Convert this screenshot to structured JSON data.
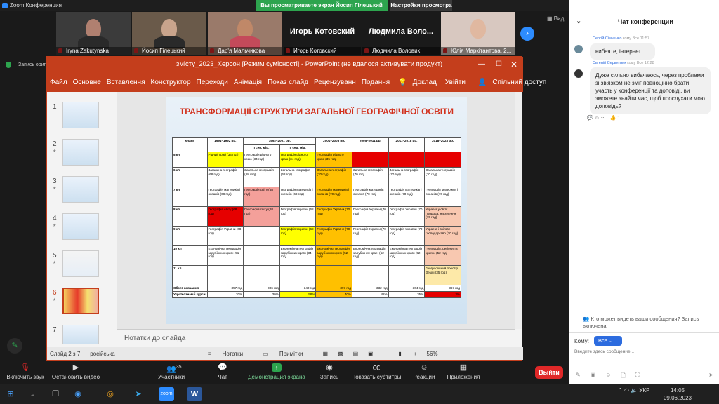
{
  "window": {
    "title": "Zoom Конференция",
    "viewing_banner": "Вы просматриваете экран Йосип Гілецький",
    "view_options": "Настройки просмотра",
    "view_label": "Вид"
  },
  "participants": [
    {
      "name": "Iryna Zakutynska"
    },
    {
      "name": "Йосип Гілецький"
    },
    {
      "name": "Дар'я Мальчикова"
    },
    {
      "name": "Игорь Котовский",
      "bigname": "Игорь Котовский"
    },
    {
      "name": "Людмила Воловик",
      "bigname": "Людмила Воло..."
    },
    {
      "name": "Юлія Маркітантова, 2..."
    }
  ],
  "share_notice": "Запись оригинала звук для музыкантов выключен",
  "ppt": {
    "title": "змісту_2023_Херсон [Режим сумісності] - PowerPoint (не вдалося активувати продукт)",
    "tabs": [
      "Файл",
      "Основне",
      "Вставлення",
      "Конструктор",
      "Переходи",
      "Анімація",
      "Показ слайд",
      "Рецензуванн",
      "Подання",
      "Доклад",
      "Увійти"
    ],
    "share": "Спільний доступ",
    "thumbs": [
      "1",
      "2",
      "3",
      "4",
      "5",
      "6",
      "7"
    ],
    "notes_placeholder": "Нотатки до слайда",
    "status": {
      "slide": "Слайд 2 з 7",
      "lang": "російська",
      "notes": "Нотатки",
      "comments": "Примітки",
      "zoom": "56%"
    }
  },
  "slide": {
    "title": "ТРАНСФОРМАЦІЇ СТРУКТУРИ ЗАГАЛЬНОЇ ГЕОГРАФІЧНОЇ ОСВІТИ",
    "headers": [
      "Класи",
      "1991–1992 рр.",
      "1992–2001 рр.",
      "2001–2005 рр.",
      "2005–2011 рр.",
      "2011–2018 рр.",
      "2018–2023 рр."
    ],
    "subheaders": [
      "І сер. мір.",
      "ІІ сер. мір."
    ],
    "rows": [
      [
        "5 кл",
        "Рідний край (34 год)",
        "Географія рідного краю (34 год)",
        "Географія рідного краю (34 год)",
        "Географія рідного краю (35 год)",
        "",
        "",
        ""
      ],
      [
        "6 кл",
        "Загальна географія (68 год)",
        "Загальна географія (68 год)",
        "Загальна географія (68 год)",
        "Загальна географія (70 год)",
        "Загальна географія (70 год)",
        "Загальна географія (70 год)",
        "Загальна географія (70 год)"
      ],
      [
        "7 кл",
        "Географія материків і океанів (68 год)",
        "Географія світу (68 год)",
        "Географія материків і океанів (68 год)",
        "Географія материків і океанів (70 год)",
        "Географія материків і океанів (70 год)",
        "Географія материків і океанів (70 год)",
        "Географія материків і океанів (70 год)"
      ],
      [
        "8 кл",
        "Географія світу (68 год)",
        "Географія світу (68 год)",
        "Географія України (68 год)",
        "Географія України (70 год)",
        "Географія України (70 год)",
        "Географія України (70 год)",
        "Україна у світі: природа, населення (70 год)"
      ],
      [
        "9 кл",
        "Географія України (68 год)",
        "",
        "Географія України (68 год)",
        "Географія України (70 год)",
        "Географія України (70 год)",
        "Географія України (70 год)",
        "Україна і світове господарство (70 год)"
      ],
      [
        "10 кл",
        "Економічна географія зарубіжних країн (51 год)",
        "",
        "Економічна географія зарубіжних країн (34 год)",
        "Економічна географія зарубіжних країн (52 год)",
        "Економічна географія зарубіжних країн (52 год)",
        "Економічна географія зарубіжних країн (52 год)",
        "Географія: регіони та країни (52 год)"
      ],
      [
        "11 кл",
        "",
        "",
        "",
        "",
        "",
        "",
        "Географічний простір Землі (35 год)"
      ],
      [
        "Обсяг навчання",
        "357 год",
        "306 год",
        "340 год",
        "397 год",
        "332 год",
        "304 год",
        "367 год"
      ],
      [
        "Українознавчі курси",
        "20%",
        "30%",
        "58%",
        "40%",
        "42%",
        "35%",
        "3%"
      ]
    ]
  },
  "chat": {
    "title": "Чат конференции",
    "messages": [
      {
        "from": "Сергій Сімченко",
        "to": "кому Все",
        "time": "11:57",
        "text": "вибачте, інтернет......"
      },
      {
        "from": "Євгеній Сервятник",
        "to": "кому Все",
        "time": "12:28",
        "text": "Дуже сильно вибачаюсь, через проблеми зі зв'язком не зміг повноцінно брати участь у конференції та доповіді, ви зможете знайти час, щоб прослухати мою доповідь?"
      }
    ],
    "reaction_count": "1",
    "privacy_note": "Кто может видеть ваши сообщения? Запись включена",
    "to_label": "Кому:",
    "to_value": "Все",
    "input_placeholder": "Введите здесь сообщение..."
  },
  "toolbar": {
    "mute": "Включить звук",
    "video": "Остановить видео",
    "participants": "Участники",
    "participants_count": "35",
    "chat": "Чат",
    "share": "Демонстрация экрана",
    "record": "Запись",
    "captions": "Показать субтитры",
    "reactions": "Реакции",
    "apps": "Приложения",
    "leave": "Выйти"
  },
  "taskbar": {
    "lang": "УКР",
    "time": "14:05",
    "date": "09.06.2023"
  },
  "colors": {
    "ppt_accent": "#c43e1c",
    "zoom_blue": "#2d8cff",
    "share_green": "#2da44e",
    "leave_red": "#e02828"
  }
}
